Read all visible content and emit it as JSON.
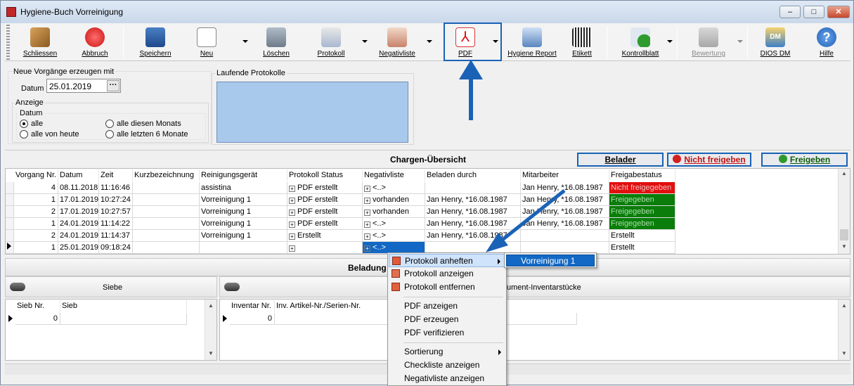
{
  "window": {
    "title": "Hygiene-Buch Vorreinigung",
    "controls": [
      "–",
      "□",
      "✕"
    ]
  },
  "toolbar": {
    "items": [
      {
        "label": "Schliessen",
        "icon": "door-exit-icon"
      },
      {
        "label": "Abbruch",
        "icon": "cancel-icon"
      },
      {
        "label": "Speichern",
        "icon": "save-icon"
      },
      {
        "label": "Neu",
        "icon": "new-document-icon"
      },
      {
        "label": "Löschen",
        "icon": "trash-icon"
      },
      {
        "label": "Protokoll",
        "icon": "protocol-icon"
      },
      {
        "label": "Negativliste",
        "icon": "clipboard-icon"
      },
      {
        "label": "PDF",
        "icon": "pdf-icon"
      },
      {
        "label": "Hygiene Report",
        "icon": "report-icon"
      },
      {
        "label": "Etikett",
        "icon": "barcode-printer-icon"
      },
      {
        "label": "Kontrollblatt",
        "icon": "checklist-icon"
      },
      {
        "label": "Bewertung",
        "icon": "rating-icon"
      },
      {
        "label": "DIOS DM",
        "icon": "dios-dm-icon"
      },
      {
        "label": "Hilfe",
        "icon": "help-icon"
      }
    ]
  },
  "new_entries": {
    "group_title": "Neue Vorgänge erzeugen mit",
    "date_label": "Datum",
    "date_value": "25.01.2019",
    "date_button": "···"
  },
  "display": {
    "group_title": "Anzeige",
    "sub_title": "Datum",
    "options": [
      "alle",
      "alle diesen Monats",
      "alle von heute",
      "alle letzten 6 Monate"
    ],
    "selected": "alle"
  },
  "running": {
    "group_title": "Laufende Protokolle"
  },
  "charges": {
    "title": "Chargen-Übersicht",
    "btn_belader": "Belader",
    "btn_not_release": "Nicht freigeben",
    "btn_release": "Freigeben",
    "columns": [
      "Vorgang Nr.",
      "Datum",
      "Zeit",
      "Kurzbezeichnung",
      "Reinigungsgerät",
      "Protokoll Status",
      "Negativliste",
      "Beladen durch",
      "Mitarbeiter",
      "Freigabestatus"
    ],
    "rows": [
      {
        "nr": "4",
        "datum": "08.11.2018",
        "zeit": "11:16:46",
        "kurz": "",
        "geraet": "assistina",
        "protokoll": "PDF erstellt",
        "negativ": "<..>",
        "beladen": "",
        "mitarbeiter": "Jan Henry, *16.08.1987",
        "status": "Nicht freigegeben",
        "status_kind": "red"
      },
      {
        "nr": "1",
        "datum": "17.01.2019",
        "zeit": "10:27:24",
        "kurz": "",
        "geraet": "Vorreinigung 1",
        "protokoll": "PDF erstellt",
        "negativ": "vorhanden",
        "beladen": "Jan Henry, *16.08.1987",
        "mitarbeiter": "Jan Henry, *16.08.1987",
        "status": "Freigegeben",
        "status_kind": "green"
      },
      {
        "nr": "2",
        "datum": "17.01.2019",
        "zeit": "10:27:57",
        "kurz": "",
        "geraet": "Vorreinigung 1",
        "protokoll": "PDF erstellt",
        "negativ": "vorhanden",
        "beladen": "Jan Henry, *16.08.1987",
        "mitarbeiter": "Jan Henry, *16.08.1987",
        "status": "Freigegeben",
        "status_kind": "green"
      },
      {
        "nr": "1",
        "datum": "24.01.2019",
        "zeit": "11:14:22",
        "kurz": "",
        "geraet": "Vorreinigung 1",
        "protokoll": "PDF erstellt",
        "negativ": "<..>",
        "beladen": "Jan Henry, *16.08.1987",
        "mitarbeiter": "Jan Henry, *16.08.1987",
        "status": "Freigegeben",
        "status_kind": "green"
      },
      {
        "nr": "2",
        "datum": "24.01.2019",
        "zeit": "11:14:37",
        "kurz": "",
        "geraet": "Vorreinigung 1",
        "protokoll": "Erstellt",
        "negativ": "<..>",
        "beladen": "Jan Henry, *16.08.1987",
        "mitarbeiter": "",
        "status": "Erstellt",
        "status_kind": "none"
      },
      {
        "nr": "1",
        "datum": "25.01.2019",
        "zeit": "09:18:24",
        "kurz": "",
        "geraet": "",
        "protokoll": "",
        "negativ": "<..>",
        "beladen": "",
        "mitarbeiter": "",
        "status": "Erstellt",
        "status_kind": "none"
      }
    ]
  },
  "loading": {
    "title": "Beladung",
    "sieve_title": "Siebe",
    "sieve_cols": [
      "Sieb Nr.",
      "Sieb"
    ],
    "sieve_value": "0",
    "instr_title_visible": "ument-Inventarstücke",
    "instr_cols": [
      "Inventar Nr.",
      "Inv. Artikel-Nr./Serien-Nr."
    ],
    "instr_value": "0"
  },
  "context_menu": {
    "items": [
      "Protokoll anheften",
      "Protokoll anzeigen",
      "Protokoll entfernen",
      "PDF anzeigen",
      "PDF erzeugen",
      "PDF verifizieren",
      "Sortierung",
      "Checkliste anzeigen",
      "Negativliste anzeigen"
    ],
    "submenu": [
      "Vorreinigung 1"
    ]
  },
  "colors": {
    "highlight": "#1a62b6",
    "green": "#0a7d0a",
    "red": "#e20f0f",
    "running_box": "#a9c9ec"
  }
}
